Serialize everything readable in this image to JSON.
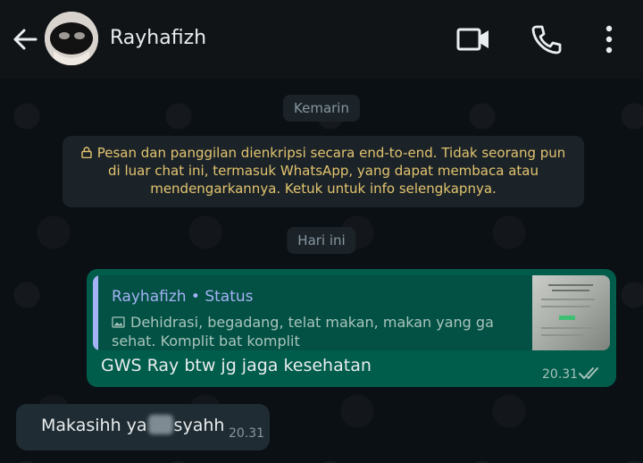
{
  "header": {
    "contact_name": "Rayhafizh",
    "icons": {
      "back": "back-arrow-icon",
      "video": "video-call-icon",
      "call": "phone-icon",
      "more": "more-vertical-icon"
    }
  },
  "chat": {
    "date_yesterday": "Kemarin",
    "encryption_notice": "Pesan dan panggilan dienkripsi secara end-to-end. Tidak seorang pun di luar chat ini, termasuk WhatsApp, yang dapat membaca atau mendengarkannya. Ketuk untuk info selengkapnya.",
    "date_today": "Hari ini",
    "messages": [
      {
        "direction": "outgoing",
        "quote": {
          "author": "Rayhafizh • Status",
          "text": "Dehidrasi, begadang, telat makan, makan yang ga sehat. Komplit bat komplit"
        },
        "text": "GWS Ray btw jg jaga kesehatan",
        "time": "20.31",
        "status": "read"
      },
      {
        "direction": "incoming",
        "text_before": "Makasihh ya",
        "text_after": "syahh",
        "time": "20.31"
      }
    ]
  },
  "colors": {
    "header_bg": "#101417",
    "chat_bg": "#0b1014",
    "outgoing_bubble": "#005c4b",
    "incoming_bubble": "#1c2328",
    "quote_accent": "#a5b2f5",
    "encryption_text": "#e2c46f",
    "read_ticks": "#a6c3bb"
  }
}
